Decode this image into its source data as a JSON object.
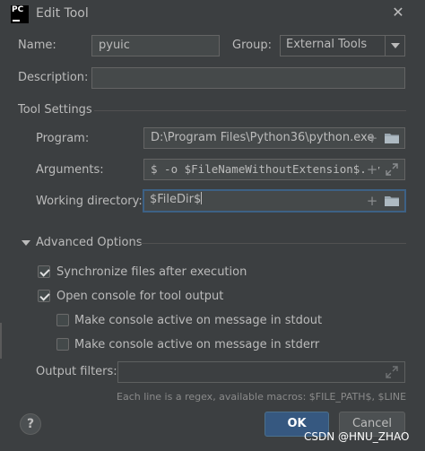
{
  "window": {
    "title": "Edit Tool",
    "app_icon_text": "PC"
  },
  "form": {
    "name_label": "Name:",
    "name_value": "pyuic",
    "group_label": "Group:",
    "group_value": "External Tools",
    "description_label": "Description:",
    "description_value": ""
  },
  "tool_settings": {
    "section_title": "Tool Settings",
    "program_label": "Program:",
    "program_value": "D:\\Program Files\\Python36\\python.exe",
    "arguments_label": "Arguments:",
    "arguments_value": "$ -o $FileNameWithoutExtension$.py",
    "working_dir_label": "Working directory:",
    "working_dir_value": "$FileDir$"
  },
  "advanced": {
    "section_title": "Advanced Options",
    "checkboxes": [
      {
        "label": "Synchronize files after execution",
        "checked": true
      },
      {
        "label": "Open console for tool output",
        "checked": true
      },
      {
        "label": "Make console active on message in stdout",
        "checked": false
      },
      {
        "label": "Make console active on message in stderr",
        "checked": false
      }
    ],
    "output_filters_label": "Output filters:",
    "output_filters_value": "",
    "hint": "Each line is a regex, available macros: $FILE_PATH$, $LINE$"
  },
  "footer": {
    "help_label": "?",
    "ok_label": "OK",
    "cancel_label": "Cancel",
    "watermark": "CSDN @HNU_ZHAO"
  },
  "colors": {
    "background": "#3c3f41",
    "input_bg": "#45494a",
    "focus_border": "#3d6185",
    "primary_button": "#365880"
  }
}
